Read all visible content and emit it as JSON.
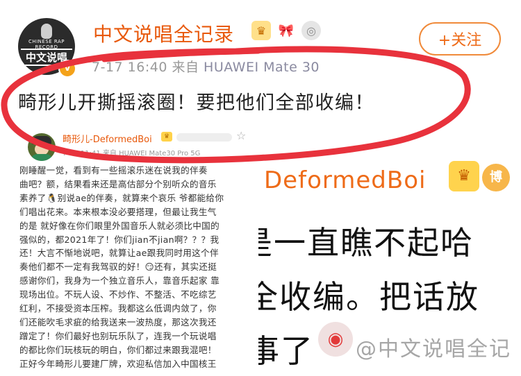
{
  "post": {
    "author": "中文说唱全记录",
    "avatar_ring_text": "CHINESE RAP RECORD",
    "avatar_logo_text": "中文说唱",
    "verified_mark": "v",
    "follow_label": "+关注",
    "timestamp": "7-17 16:40",
    "source_prefix": "来自",
    "device": "HUAWEI Mate 30",
    "text": "畸形儿开撕摇滚圈！要把他们全部收编！"
  },
  "embedded": {
    "author": "畸形儿-DeformedBoi",
    "timestamp": "7-17 11:41",
    "source": "来自 HUAWEI Mate30 Pro 5G",
    "crown_badge": "♛",
    "star_icon": "☆",
    "lines": [
      "刚睡醒一觉，看到有一些摇滚乐迷在说我的伴奏",
      "曲吧？额，结果看来还是高估部分个别听众的音乐",
      "素养了🐧别说ae的伴奏，就算来个哀乐 爷都能给你",
      "们唱出花来。本来根本没必要搭理，但最让我生气",
      "的是 就好像在你们眼里外国音乐人就必须比中国的",
      "强似的，都2021年了！你们jian不jian啊？？？我",
      "还！大言不惭地说吧，就算让ae跟我同时用这个伴",
      "奏他们都不一定有我驾驭的好！😏还有，其实还挺",
      "感谢你们，我身为一个独立音乐人，靠音乐起家 靠",
      "现场出位。不玩人设、不炒作、不整活、不吃综艺",
      "红利，不接受资本压榨。我都这么低调内敛了，你",
      "们还能吹毛求疵的给我送来一波热度，那这次我还",
      "蹭定了！你们最好也别玩乐队了，连我一个玩说唱",
      "的都比你们玩核玩的明白，你们都过来跟我混吧！",
      "正好今年畸形儿要建厂牌，欢迎私信加入中国核王"
    ]
  },
  "background": {
    "name_fragment": "DeformedBoi",
    "bo_badge": "博",
    "line1": "是一直瞧不起哈",
    "line2": "全收编。把话放",
    "line3": "事了",
    "watermark": "@中文说唱全记"
  },
  "colors": {
    "accent_orange": "#ee6b18",
    "circle_red": "#e8323c",
    "text_dark": "#222222",
    "meta_gray": "#9a9a9a"
  },
  "icons": {
    "crown": "♛",
    "bow": "🎀",
    "medal": "◎",
    "weibo_logo": "◉"
  }
}
